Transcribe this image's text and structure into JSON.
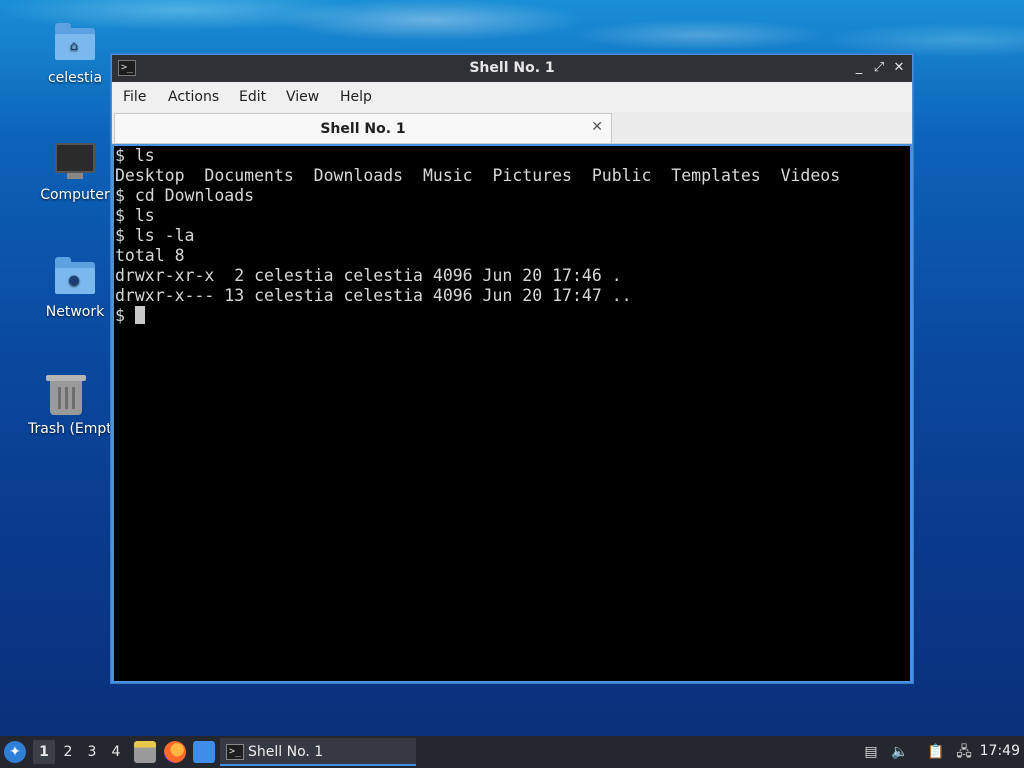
{
  "desktop": {
    "icons": [
      {
        "label": "celestia",
        "icon": "home-folder-icon"
      },
      {
        "label": "Computer",
        "icon": "computer-icon"
      },
      {
        "label": "Network",
        "icon": "network-folder-icon"
      },
      {
        "label": "Trash (Empty)",
        "icon": "trash-icon"
      }
    ]
  },
  "window": {
    "title": "Shell No. 1",
    "controls": {
      "minimize": "_",
      "maximize": "⤢",
      "close": "✕"
    },
    "menu": [
      "File",
      "Actions",
      "Edit",
      "View",
      "Help"
    ],
    "tab": {
      "label": "Shell No. 1",
      "close": "✕"
    },
    "terminal": {
      "lines": [
        "$ ls",
        "Desktop  Documents  Downloads  Music  Pictures  Public  Templates  Videos",
        "$ cd Downloads",
        "$ ls",
        "$ ls -la",
        "total 8",
        "drwxr-xr-x  2 celestia celestia 4096 Jun 20 17:46 .",
        "drwxr-x--- 13 celestia celestia 4096 Jun 20 17:47 ..",
        "$ "
      ]
    }
  },
  "taskbar": {
    "workspaces": [
      "1",
      "2",
      "3",
      "4"
    ],
    "active_workspace": "1",
    "task": {
      "label": "Shell No. 1"
    },
    "clock": "17:49"
  }
}
